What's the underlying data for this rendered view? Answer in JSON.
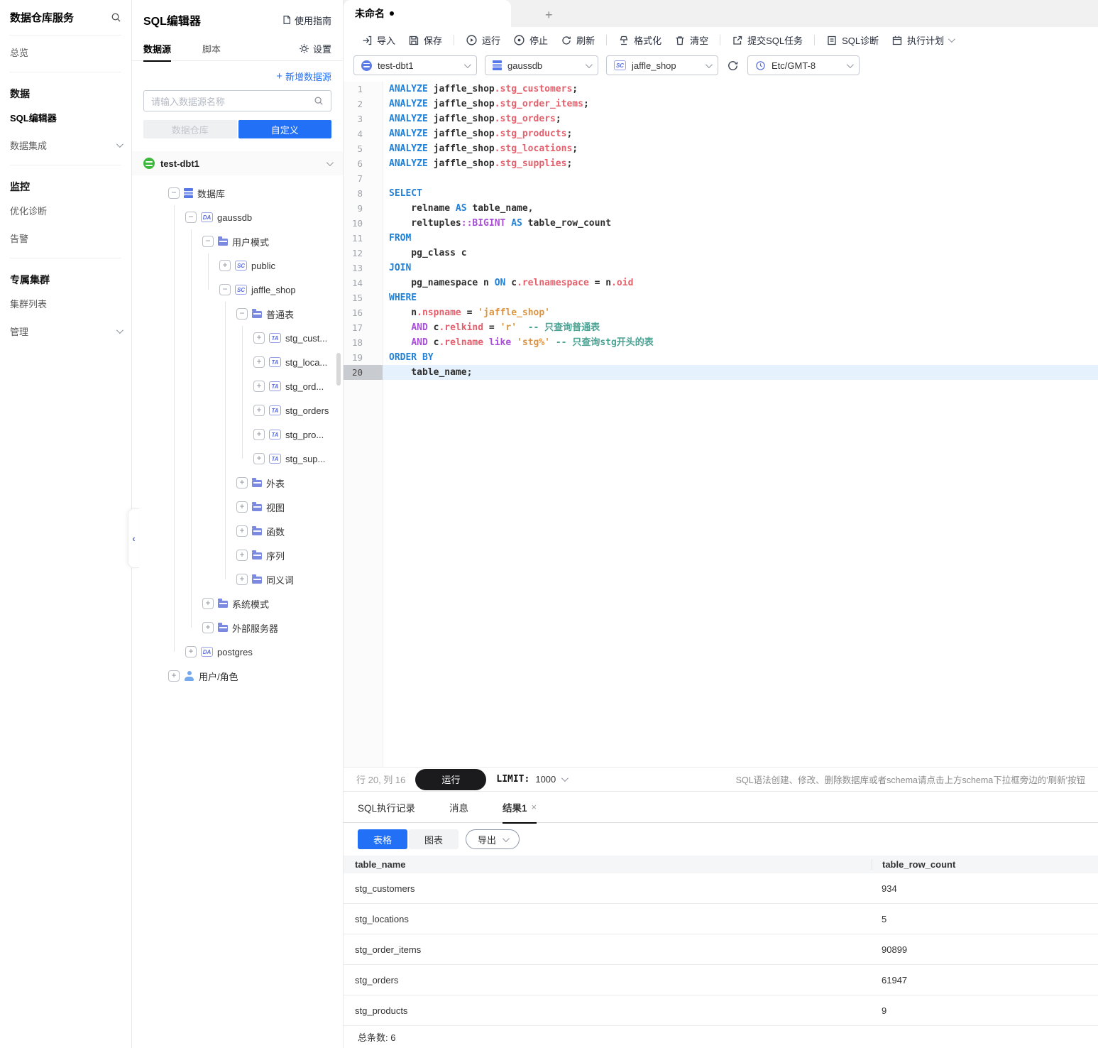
{
  "accent": "#2170f5",
  "sidebar": {
    "title": "数据仓库服务",
    "groups": [
      {
        "items": [
          {
            "label": "总览"
          }
        ]
      },
      {
        "header": "数据",
        "items": [
          {
            "label": "SQL编辑器",
            "active": true
          },
          {
            "label": "数据集成",
            "chevron": true
          }
        ]
      },
      {
        "header": "监控",
        "items": [
          {
            "label": "优化诊断"
          },
          {
            "label": "告警"
          }
        ]
      },
      {
        "header": "专属集群",
        "items": [
          {
            "label": "集群列表"
          },
          {
            "label": "管理",
            "chevron": true
          }
        ]
      }
    ]
  },
  "panel": {
    "title": "SQL编辑器",
    "guide": "使用指南",
    "tabs": [
      {
        "label": "数据源",
        "active": true
      },
      {
        "label": "脚本",
        "active": false
      }
    ],
    "settings": "设置",
    "add_datasource": "新增数据源",
    "search_placeholder": "请输入数据源名称",
    "toggle": [
      {
        "label": "数据仓库",
        "active": false
      },
      {
        "label": "自定义",
        "active": true
      }
    ],
    "connection": "test-dbt1",
    "tree": [
      {
        "label": "数据库",
        "level": 1,
        "exp": "-",
        "icon": "dbstack"
      },
      {
        "label": "gaussdb",
        "level": 2,
        "exp": "-",
        "icon": "badge",
        "badge": "DA"
      },
      {
        "label": "用户模式",
        "level": 3,
        "exp": "-",
        "icon": "folder"
      },
      {
        "label": "public",
        "level": 4,
        "exp": "+",
        "icon": "badge",
        "badge": "SC"
      },
      {
        "label": "jaffle_shop",
        "level": 4,
        "exp": "-",
        "icon": "badge",
        "badge": "SC"
      },
      {
        "label": "普通表",
        "level": 5,
        "exp": "-",
        "icon": "folder"
      },
      {
        "label": "stg_cust...",
        "level": 6,
        "exp": "+",
        "icon": "badge",
        "badge": "TA"
      },
      {
        "label": "stg_loca...",
        "level": 6,
        "exp": "+",
        "icon": "badge",
        "badge": "TA"
      },
      {
        "label": "stg_ord...",
        "level": 6,
        "exp": "+",
        "icon": "badge",
        "badge": "TA"
      },
      {
        "label": "stg_orders",
        "level": 6,
        "exp": "+",
        "icon": "badge",
        "badge": "TA"
      },
      {
        "label": "stg_pro...",
        "level": 6,
        "exp": "+",
        "icon": "badge",
        "badge": "TA"
      },
      {
        "label": "stg_sup...",
        "level": 6,
        "exp": "+",
        "icon": "badge",
        "badge": "TA"
      },
      {
        "label": "外表",
        "level": 5,
        "exp": "+",
        "icon": "folder"
      },
      {
        "label": "视图",
        "level": 5,
        "exp": "+",
        "icon": "folder"
      },
      {
        "label": "函数",
        "level": 5,
        "exp": "+",
        "icon": "folder"
      },
      {
        "label": "序列",
        "level": 5,
        "exp": "+",
        "icon": "folder"
      },
      {
        "label": "同义词",
        "level": 5,
        "exp": "+",
        "icon": "folder"
      },
      {
        "label": "系统模式",
        "level": 3,
        "exp": "+",
        "icon": "folder"
      },
      {
        "label": "外部服务器",
        "level": 3,
        "exp": "+",
        "icon": "folder"
      },
      {
        "label": "postgres",
        "level": 2,
        "exp": "+",
        "icon": "badge",
        "badge": "DA"
      },
      {
        "label": "用户/角色",
        "level": 1,
        "exp": "+",
        "icon": "user"
      }
    ]
  },
  "editor": {
    "tab": "未命名",
    "toolbar": {
      "import": "导入",
      "save": "保存",
      "run": "运行",
      "stop": "停止",
      "refresh": "刷新",
      "format": "格式化",
      "clear": "清空",
      "submit": "提交SQL任务",
      "diagnose": "SQL诊断",
      "plan": "执行计划"
    },
    "selectors": {
      "connection": "test-dbt1",
      "database": "gaussdb",
      "schema": "jaffle_shop",
      "schema_badge": "SC",
      "timezone": "Etc/GMT-8"
    },
    "code": [
      {
        "n": "1",
        "tk": [
          [
            "ANALYZE",
            "kw"
          ],
          [
            " jaffle_shop",
            "pl"
          ],
          [
            ".stg_customers",
            "pr"
          ],
          [
            ";",
            "pl"
          ]
        ]
      },
      {
        "n": "2",
        "tk": [
          [
            "ANALYZE",
            "kw"
          ],
          [
            " jaffle_shop",
            "pl"
          ],
          [
            ".stg_order_items",
            "pr"
          ],
          [
            ";",
            "pl"
          ]
        ]
      },
      {
        "n": "3",
        "tk": [
          [
            "ANALYZE",
            "kw"
          ],
          [
            " jaffle_shop",
            "pl"
          ],
          [
            ".stg_orders",
            "pr"
          ],
          [
            ";",
            "pl"
          ]
        ]
      },
      {
        "n": "4",
        "tk": [
          [
            "ANALYZE",
            "kw"
          ],
          [
            " jaffle_shop",
            "pl"
          ],
          [
            ".stg_products",
            "pr"
          ],
          [
            ";",
            "pl"
          ]
        ]
      },
      {
        "n": "5",
        "tk": [
          [
            "ANALYZE",
            "kw"
          ],
          [
            " jaffle_shop",
            "pl"
          ],
          [
            ".stg_locations",
            "pr"
          ],
          [
            ";",
            "pl"
          ]
        ]
      },
      {
        "n": "6",
        "tk": [
          [
            "ANALYZE",
            "kw"
          ],
          [
            " jaffle_shop",
            "pl"
          ],
          [
            ".stg_supplies",
            "pr"
          ],
          [
            ";",
            "pl"
          ]
        ]
      },
      {
        "n": "7",
        "tk": []
      },
      {
        "n": "8",
        "tk": [
          [
            "SELECT",
            "kw"
          ]
        ]
      },
      {
        "n": "9",
        "tk": [
          [
            "    relname ",
            "pl"
          ],
          [
            "AS",
            "kw"
          ],
          [
            " table_name,",
            "pl"
          ]
        ]
      },
      {
        "n": "10",
        "tk": [
          [
            "    reltuples",
            "pl"
          ],
          [
            "::BIGINT",
            "op"
          ],
          [
            " ",
            "pl"
          ],
          [
            "AS",
            "kw"
          ],
          [
            " table_row_count",
            "pl"
          ]
        ]
      },
      {
        "n": "11",
        "tk": [
          [
            "FROM",
            "kw"
          ]
        ]
      },
      {
        "n": "12",
        "tk": [
          [
            "    pg_class c",
            "pl"
          ]
        ]
      },
      {
        "n": "13",
        "tk": [
          [
            "JOIN",
            "kw"
          ]
        ]
      },
      {
        "n": "14",
        "tk": [
          [
            "    pg_namespace n ",
            "pl"
          ],
          [
            "ON",
            "kw"
          ],
          [
            " c",
            "pl"
          ],
          [
            ".relnamespace",
            "pr"
          ],
          [
            " = n",
            "pl"
          ],
          [
            ".oid",
            "pr"
          ]
        ]
      },
      {
        "n": "15",
        "tk": [
          [
            "WHERE",
            "kw"
          ]
        ]
      },
      {
        "n": "16",
        "tk": [
          [
            "    n",
            "pl"
          ],
          [
            ".nspname",
            "pr"
          ],
          [
            " = ",
            "pl"
          ],
          [
            "'jaffle_shop'",
            "str"
          ]
        ]
      },
      {
        "n": "17",
        "tk": [
          [
            "    ",
            "pl"
          ],
          [
            "AND",
            "op"
          ],
          [
            " c",
            "pl"
          ],
          [
            ".relkind",
            "pr"
          ],
          [
            " = ",
            "pl"
          ],
          [
            "'r'",
            "str"
          ],
          [
            "  ",
            "pl"
          ],
          [
            "-- 只查询普通表",
            "cm"
          ]
        ]
      },
      {
        "n": "18",
        "tk": [
          [
            "    ",
            "pl"
          ],
          [
            "AND",
            "op"
          ],
          [
            " c",
            "pl"
          ],
          [
            ".relname",
            "pr"
          ],
          [
            " ",
            "pl"
          ],
          [
            "like",
            "op"
          ],
          [
            " ",
            "pl"
          ],
          [
            "'stg%'",
            "str"
          ],
          [
            " ",
            "pl"
          ],
          [
            "-- 只查询stg开头的表",
            "cm"
          ]
        ]
      },
      {
        "n": "19",
        "tk": [
          [
            "ORDER BY",
            "kw"
          ]
        ]
      },
      {
        "n": "20",
        "tk": [
          [
            "    table_name;",
            "pl"
          ]
        ],
        "active": true
      }
    ],
    "status": {
      "position": "行 20, 列 16",
      "run": "运行",
      "limit_label": "LIMIT:",
      "limit_value": "1000",
      "hint": "SQL语法创建、修改、删除数据库或者schema请点击上方schema下拉框旁边的'刷新'按钮"
    }
  },
  "results": {
    "tabs": [
      {
        "label": "SQL执行记录"
      },
      {
        "label": "消息"
      },
      {
        "label": "结果1",
        "active": true,
        "closable": true
      }
    ],
    "views": [
      {
        "label": "表格",
        "active": true
      },
      {
        "label": "图表",
        "active": false
      }
    ],
    "export_label": "导出",
    "columns": [
      "table_name",
      "table_row_count"
    ],
    "rows": [
      [
        "stg_customers",
        "934"
      ],
      [
        "stg_locations",
        "5"
      ],
      [
        "stg_order_items",
        "90899"
      ],
      [
        "stg_orders",
        "61947"
      ],
      [
        "stg_products",
        "9"
      ]
    ],
    "total": "总条数: 6"
  }
}
